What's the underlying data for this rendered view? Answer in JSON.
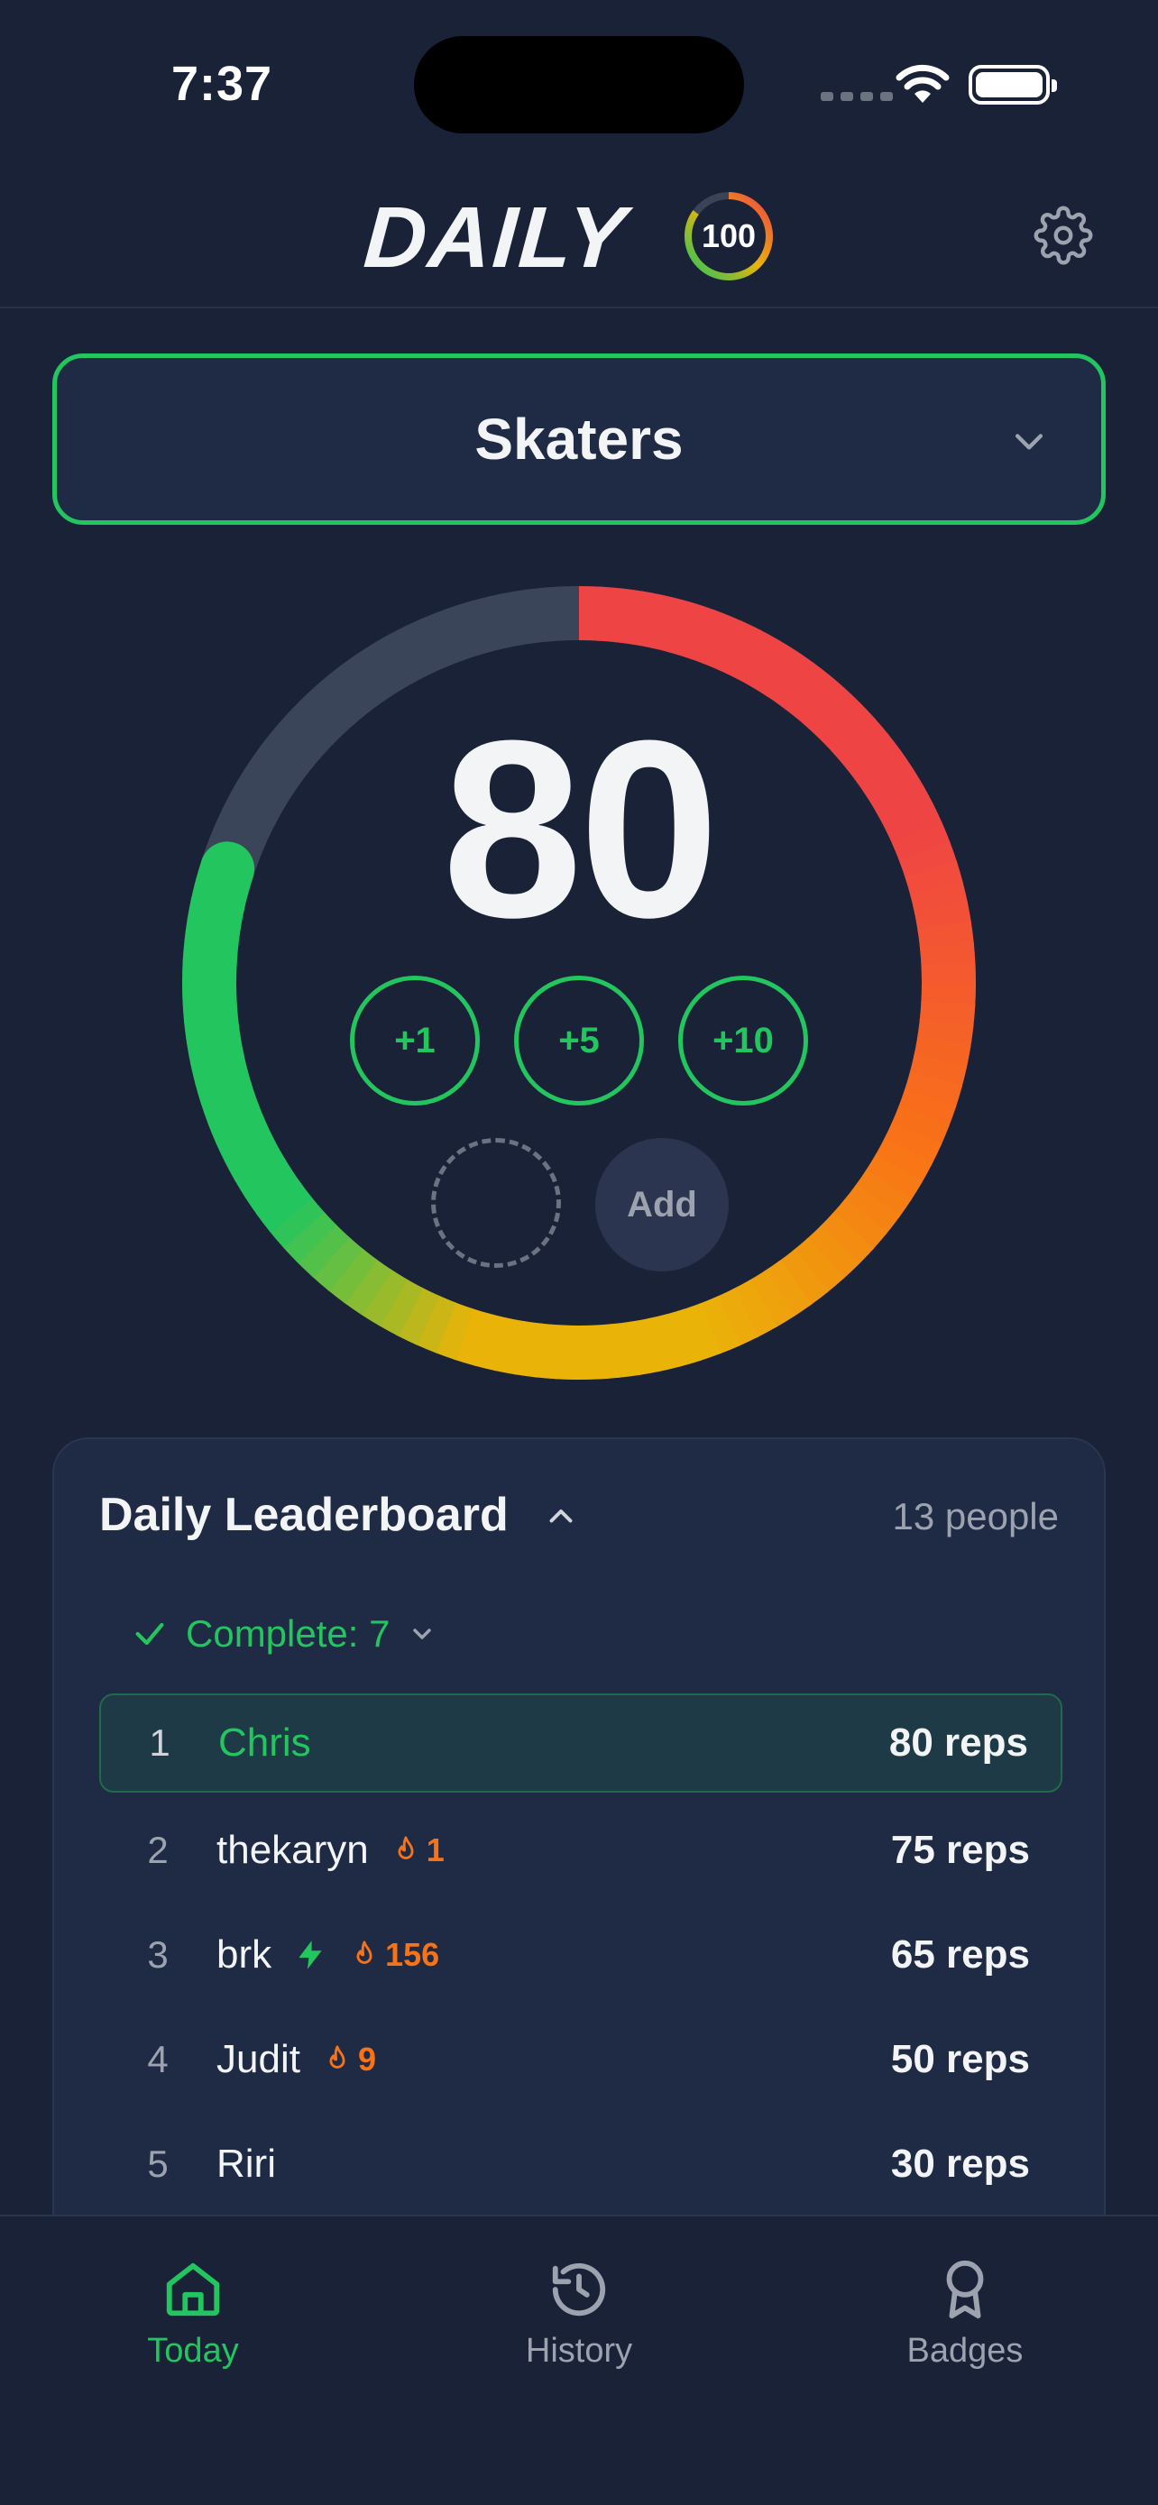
{
  "status": {
    "time": "7:37"
  },
  "header": {
    "logo": "DAILY",
    "badge": "100"
  },
  "group": {
    "name": "Skaters"
  },
  "counter": {
    "value": "80",
    "progress": 0.8,
    "increments": [
      "+1",
      "+5",
      "+10"
    ],
    "add_label": "Add"
  },
  "leaderboard": {
    "title": "Daily Leaderboard",
    "count": "13 people",
    "complete_label": "Complete: 7",
    "rows": [
      {
        "rank": "1",
        "name": "Chris",
        "reps": "80 reps",
        "streak": "",
        "bolt": false,
        "me": true
      },
      {
        "rank": "2",
        "name": "thekaryn",
        "reps": "75 reps",
        "streak": "1",
        "bolt": false,
        "me": false
      },
      {
        "rank": "3",
        "name": "brk",
        "reps": "65 reps",
        "streak": "156",
        "bolt": true,
        "me": false
      },
      {
        "rank": "4",
        "name": "Judit",
        "reps": "50 reps",
        "streak": "9",
        "bolt": false,
        "me": false
      },
      {
        "rank": "5",
        "name": "Riri",
        "reps": "30 reps",
        "streak": "",
        "bolt": false,
        "me": false
      }
    ]
  },
  "tabs": [
    {
      "label": "Today",
      "icon": "home-icon",
      "active": true
    },
    {
      "label": "History",
      "icon": "history-icon",
      "active": false
    },
    {
      "label": "Badges",
      "icon": "badge-icon",
      "active": false
    }
  ],
  "colors": {
    "accent": "#22c55e",
    "streak": "#f97316",
    "background": "#1a2238"
  }
}
